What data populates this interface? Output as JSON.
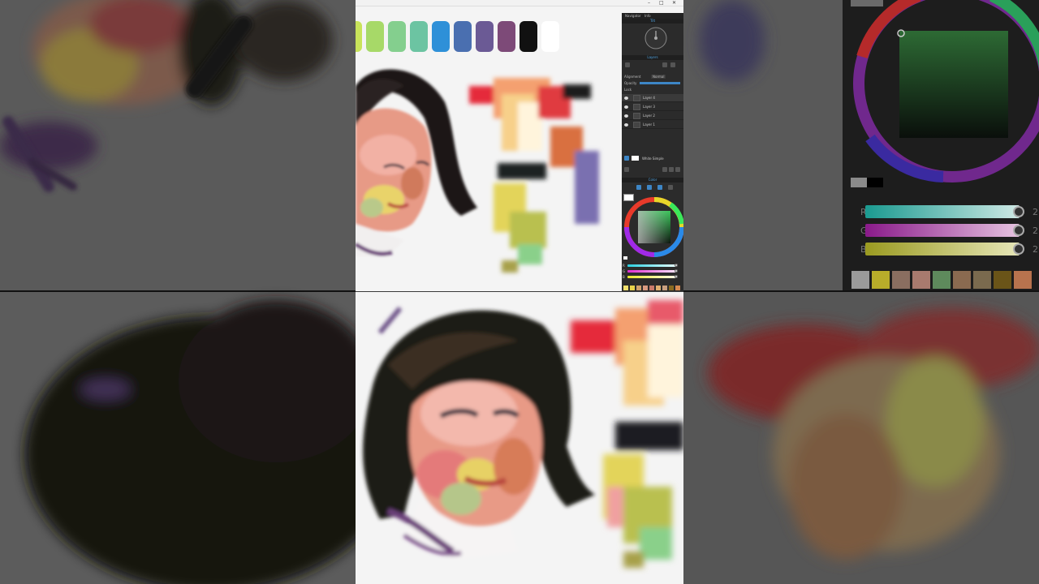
{
  "window": {
    "title": "",
    "controls": [
      "–",
      "□",
      "✕"
    ]
  },
  "palette_strokes": [
    "#c8e35a",
    "#a7d968",
    "#84cf8e",
    "#6cc4a2",
    "#2e90d8",
    "#4a6fb0",
    "#6b5a95",
    "#7d4a78",
    "#111111",
    "#ffffff"
  ],
  "navigator": {
    "tabs": [
      "Navigator",
      "Info"
    ],
    "zoom_label": "Tilt"
  },
  "layers": {
    "header": "Layers",
    "alignment_label": "Alignment",
    "alignment_value": "Normal",
    "opacity_label": "Opacity",
    "lock_label": "Lock",
    "items": [
      {
        "name": "Layer 4",
        "selected": true
      },
      {
        "name": "Layer 3",
        "selected": false
      },
      {
        "name": "Layer 2",
        "selected": false
      },
      {
        "name": "Layer 1",
        "selected": false
      }
    ],
    "paper_label": "White Simple"
  },
  "color": {
    "header": "Color",
    "channels": [
      "R",
      "G",
      "B"
    ],
    "active_color": "#2e9e46",
    "swatches": [
      "#f2e06b",
      "#e8d24a",
      "#cfa06a",
      "#d99a80",
      "#c97a6a",
      "#e0b070",
      "#c9a080",
      "#8a6a20",
      "#d98a50"
    ]
  },
  "right_panel": {
    "channels": [
      "R",
      "G",
      "B"
    ],
    "values": [
      "2",
      "2",
      "2"
    ],
    "swatches": [
      "#9a9a9a",
      "#b8ad2a",
      "#8a6e60",
      "#a87a6e",
      "#5e8a5c",
      "#8a6a50",
      "#7a6a4e",
      "#6a5418",
      "#b7734e"
    ]
  }
}
